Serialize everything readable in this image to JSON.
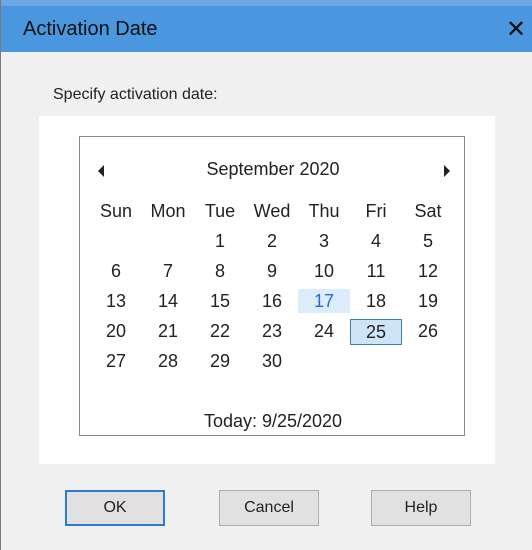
{
  "window": {
    "title": "Activation Date",
    "close_label": "✕"
  },
  "prompt": "Specify activation date:",
  "calendar": {
    "month_year": "September 2020",
    "days_of_week": [
      "Sun",
      "Mon",
      "Tue",
      "Wed",
      "Thu",
      "Fri",
      "Sat"
    ],
    "weeks": [
      [
        "",
        "",
        "1",
        "2",
        "3",
        "4",
        "5"
      ],
      [
        "6",
        "7",
        "8",
        "9",
        "10",
        "11",
        "12"
      ],
      [
        "13",
        "14",
        "15",
        "16",
        "17",
        "18",
        "19"
      ],
      [
        "20",
        "21",
        "22",
        "23",
        "24",
        "25",
        "26"
      ],
      [
        "27",
        "28",
        "29",
        "30",
        "",
        "",
        ""
      ]
    ],
    "hovered_day": "17",
    "selected_day": "25",
    "today_label": "Today: 9/25/2020"
  },
  "buttons": {
    "ok": "OK",
    "cancel": "Cancel",
    "help": "Help"
  },
  "colors": {
    "titlebar": "#4a97e0",
    "selection": "#cde5f7",
    "hover": "#ddecfb"
  }
}
